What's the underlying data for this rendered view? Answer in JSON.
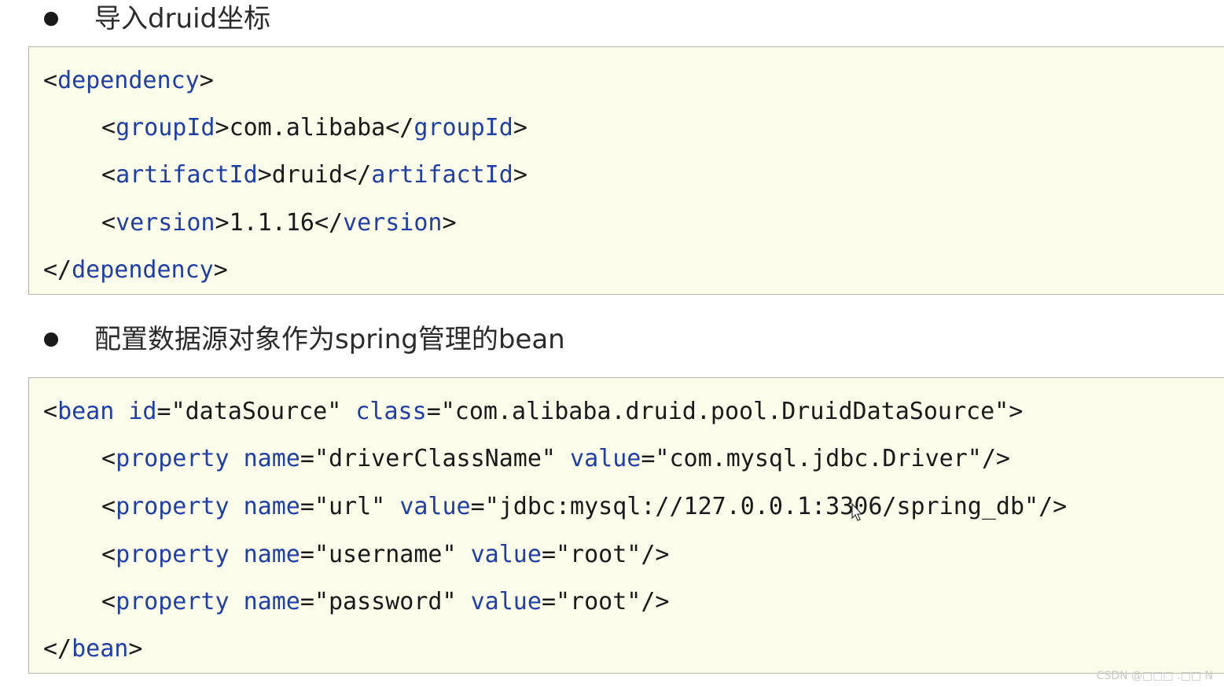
{
  "sections": [
    {
      "heading": "导入druid坐标",
      "code": {
        "dep_open_lt": "<",
        "dep_open_tag": "dependency",
        "dep_open_gt": ">",
        "group_lt": "<",
        "group_tag": "groupId",
        "group_gt": ">",
        "group_value": "com.alibaba",
        "group_close_lt": "</",
        "group_close_tag": "groupId",
        "group_close_gt": ">",
        "artifact_lt": "<",
        "artifact_tag": "artifactId",
        "artifact_gt": ">",
        "artifact_value": "druid",
        "artifact_close_lt": "</",
        "artifact_close_tag": "artifactId",
        "artifact_close_gt": ">",
        "version_lt": "<",
        "version_tag": "version",
        "version_gt": ">",
        "version_value": "1.1.16",
        "version_close_lt": "</",
        "version_close_tag": "version",
        "version_close_gt": ">",
        "dep_close_lt": "</",
        "dep_close_tag": "dependency",
        "dep_close_gt": ">"
      }
    },
    {
      "heading": "配置数据源对象作为spring管理的bean",
      "code": {
        "bean_lt": "<",
        "bean_tag": "bean",
        "bean_id_attr": "id",
        "bean_id_eq": "=",
        "bean_id_val": "\"dataSource\"",
        "bean_class_attr": "class",
        "bean_class_eq": "=",
        "bean_class_val": "\"com.alibaba.druid.pool.DruidDataSource\"",
        "bean_gt": ">",
        "properties": [
          {
            "lt": "<",
            "tag": "property",
            "name_attr": "name",
            "eq1": "=",
            "name_val": "\"driverClassName\"",
            "value_attr": "value",
            "eq2": "=",
            "value_val": "\"com.mysql.jdbc.Driver\"",
            "end": "/>"
          },
          {
            "lt": "<",
            "tag": "property",
            "name_attr": "name",
            "eq1": "=",
            "name_val": "\"url\"",
            "value_attr": "value",
            "eq2": "=",
            "value_val": "\"jdbc:mysql://127.0.0.1:3306/spring_db\"",
            "end": "/>"
          },
          {
            "lt": "<",
            "tag": "property",
            "name_attr": "name",
            "eq1": "=",
            "name_val": "\"username\"",
            "value_attr": "value",
            "eq2": "=",
            "value_val": "\"root\"",
            "end": "/>"
          },
          {
            "lt": "<",
            "tag": "property",
            "name_attr": "name",
            "eq1": "=",
            "name_val": "\"password\"",
            "value_attr": "value",
            "eq2": "=",
            "value_val": "\"root\"",
            "end": "/>"
          }
        ],
        "bean_close_lt": "</",
        "bean_close_tag": "bean",
        "bean_close_gt": ">"
      }
    }
  ],
  "watermark": "CSDN @□□□ .□□ N",
  "colors": {
    "code_background": "#fcfcea",
    "tag_color": "#1f3fa8",
    "text_color": "#1a1a1a",
    "border_color": "#b5b5a5"
  }
}
